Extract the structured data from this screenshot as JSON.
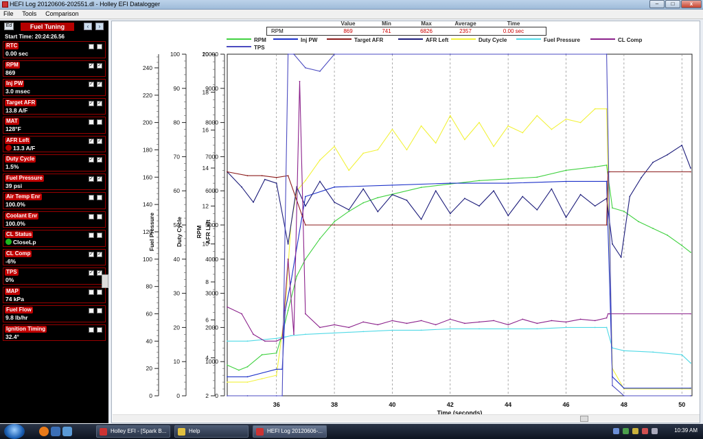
{
  "window": {
    "title": "HEFI Log 20120606-202551.dl - Holley EFI Datalogger",
    "min_label": "–",
    "max_label": "□",
    "close_label": "x"
  },
  "menu": [
    "File",
    "Tools",
    "Comparison"
  ],
  "sidebar": {
    "ed_label": "Ed",
    "title": "Fuel Tuning",
    "start_time": "Start Time: 20:24:26.56",
    "params": [
      {
        "label": "RTC",
        "value": "0.00 sec",
        "chk1": false,
        "chk2": false
      },
      {
        "label": "RPM",
        "value": "869",
        "chk1": true,
        "chk2": true
      },
      {
        "label": "Inj PW",
        "value": "3.0 msec",
        "chk1": true,
        "chk2": true
      },
      {
        "label": "Target AFR",
        "value": "13.8 A/F",
        "chk1": true,
        "chk2": true
      },
      {
        "label": "MAT",
        "value": "128°F",
        "chk1": false,
        "chk2": false
      },
      {
        "label": "AFR Left",
        "value": "13.3 A/F",
        "chk1": true,
        "chk2": true,
        "dot": "#c00000"
      },
      {
        "label": "Duty Cycle",
        "value": "1.5%",
        "chk1": true,
        "chk2": true
      },
      {
        "label": "Fuel Pressure",
        "value": "39 psi",
        "chk1": true,
        "chk2": true
      },
      {
        "label": "Air Temp Enr",
        "value": "100.0%",
        "chk1": false,
        "chk2": false
      },
      {
        "label": "Coolant Enr",
        "value": "100.0%",
        "chk1": false,
        "chk2": false
      },
      {
        "label": "CL Status",
        "value": "CloseLp",
        "chk1": false,
        "chk2": false,
        "dot": "#1fb81f"
      },
      {
        "label": "CL Comp",
        "value": "-6%",
        "chk1": true,
        "chk2": true
      },
      {
        "label": "TPS",
        "value": "0%",
        "chk1": true,
        "chk2": true
      },
      {
        "label": "MAP",
        "value": "74 kPa",
        "chk1": false,
        "chk2": false
      },
      {
        "label": "Fuel Flow",
        "value": "9.8 lb/hr",
        "chk1": false,
        "chk2": false
      },
      {
        "label": "Ignition Timing",
        "value": "32.4°",
        "chk1": false,
        "chk2": false
      }
    ]
  },
  "readout": {
    "headers": [
      "Value",
      "Min",
      "Max",
      "Average",
      "Time"
    ],
    "channel": "RPM",
    "values": [
      "869",
      "741",
      "6826",
      "2357",
      "0.00 sec"
    ]
  },
  "legend": [
    {
      "name": "RPM",
      "color": "#3fd13f"
    },
    {
      "name": "Inj PW",
      "color": "#1a2fc8"
    },
    {
      "name": "Target AFR",
      "color": "#8b1a1a"
    },
    {
      "name": "AFR Left",
      "color": "#1c1c7a"
    },
    {
      "name": "Duty Cycle",
      "color": "#f2f23a"
    },
    {
      "name": "Fuel Pressure",
      "color": "#4fd9e6"
    },
    {
      "name": "CL Comp",
      "color": "#8a1f8a"
    },
    {
      "name": "TPS",
      "color": "#4a4ac0"
    }
  ],
  "chart_data": {
    "type": "line",
    "xlabel": "Time (seconds)",
    "xlim": [
      34.3,
      50.35
    ],
    "xticks": [
      36,
      38,
      40,
      42,
      44,
      46,
      48,
      50
    ],
    "grid": true,
    "axes": [
      {
        "label": "Fuel Pressure",
        "range": [
          0,
          250
        ],
        "ticks": [
          0,
          20,
          40,
          60,
          80,
          100,
          120,
          140,
          160,
          180,
          200,
          220,
          240
        ]
      },
      {
        "label": "Duty Cycle",
        "range": [
          0,
          100
        ],
        "ticks": [
          0,
          10,
          20,
          30,
          40,
          50,
          60,
          70,
          80,
          90,
          100
        ]
      },
      {
        "label": "AFR Left",
        "range": [
          2,
          20
        ],
        "ticks": [
          2,
          4,
          6,
          8,
          10,
          12,
          14,
          16,
          18,
          20
        ]
      },
      {
        "label": "RPM",
        "range": [
          0,
          10000
        ],
        "ticks": [
          0,
          1000,
          2000,
          3000,
          4000,
          5000,
          6000,
          7000,
          8000,
          9000,
          10000
        ]
      }
    ],
    "series": [
      {
        "name": "RPM",
        "axis": 3,
        "x": [
          34.3,
          34.7,
          35.0,
          35.5,
          36.0,
          36.2,
          36.4,
          36.7,
          37.0,
          37.5,
          38.0,
          38.5,
          39.0,
          39.5,
          40.0,
          41.0,
          42.0,
          43.0,
          44.0,
          45.0,
          46.0,
          47.0,
          47.4,
          47.6,
          48.0,
          48.5,
          49.0,
          49.5,
          50.0,
          50.3
        ],
        "y": [
          900,
          750,
          850,
          1200,
          1250,
          1800,
          2500,
          3500,
          4000,
          4600,
          5100,
          5400,
          5650,
          5800,
          5900,
          6100,
          6200,
          6300,
          6350,
          6400,
          6600,
          6700,
          6750,
          5500,
          5400,
          5100,
          4900,
          4700,
          4400,
          4200
        ]
      },
      {
        "name": "Duty Cycle",
        "axis": 1,
        "x": [
          34.3,
          35.0,
          35.5,
          36.0,
          36.3,
          36.5,
          36.7,
          37.0,
          37.5,
          38.0,
          38.5,
          39.0,
          39.5,
          40.0,
          40.5,
          41.0,
          41.5,
          42.0,
          42.5,
          43.0,
          43.5,
          44.0,
          44.5,
          45.0,
          45.5,
          46.0,
          46.5,
          47.0,
          47.4,
          47.6,
          48.0,
          50.3
        ],
        "y": [
          4,
          4,
          5,
          6,
          25,
          50,
          60,
          63,
          69,
          73,
          66,
          71,
          72,
          78,
          72,
          79,
          74,
          82,
          75,
          80,
          73,
          79,
          77,
          82,
          78,
          81,
          80,
          84,
          84,
          8,
          2,
          2
        ]
      },
      {
        "name": "Fuel Pressure",
        "axis": 0,
        "x": [
          34.3,
          35.0,
          35.5,
          36.0,
          36.3,
          36.5,
          37.0,
          38.0,
          39.0,
          40.0,
          41.0,
          42.0,
          43.0,
          44.0,
          45.0,
          46.0,
          47.0,
          47.4,
          47.6,
          48.0,
          49.0,
          50.0,
          50.3
        ],
        "y": [
          40,
          40,
          41,
          42,
          43,
          44,
          45,
          46,
          47,
          48,
          48,
          49,
          49,
          49,
          49,
          50,
          50,
          50,
          35,
          33,
          32,
          30,
          24
        ]
      },
      {
        "name": "Inj PW",
        "axis": 2,
        "x": [
          34.3,
          35.0,
          36.0,
          36.2,
          36.3,
          36.5,
          37.0,
          38.0,
          40.0,
          42.0,
          44.0,
          46.0,
          47.4,
          47.6,
          48.0,
          50.3
        ],
        "y": [
          3.0,
          3.0,
          3.4,
          3.4,
          6.5,
          8.0,
          12.5,
          13.0,
          13.1,
          13.2,
          13.2,
          13.3,
          13.3,
          3.0,
          2.4,
          2.4
        ]
      },
      {
        "name": "AFR Left",
        "axis": 2,
        "x": [
          34.3,
          34.8,
          35.2,
          35.6,
          36.0,
          36.4,
          36.7,
          37.0,
          37.5,
          38.0,
          38.5,
          39.0,
          39.5,
          40.0,
          40.5,
          41.0,
          41.5,
          42.0,
          42.5,
          43.0,
          43.5,
          44.0,
          44.5,
          45.0,
          45.5,
          46.0,
          46.5,
          47.0,
          47.4,
          47.6,
          47.9,
          48.2,
          48.6,
          49.0,
          49.5,
          50.0,
          50.3
        ],
        "y": [
          13.8,
          13.0,
          12.2,
          13.4,
          13.2,
          10.0,
          13.0,
          12.0,
          13.3,
          12.2,
          11.8,
          12.9,
          11.7,
          12.6,
          12.3,
          11.3,
          12.8,
          11.6,
          12.4,
          12.0,
          12.8,
          11.5,
          12.5,
          11.8,
          12.9,
          11.4,
          12.6,
          12.0,
          12.4,
          10.0,
          9.3,
          12.5,
          13.5,
          14.3,
          14.7,
          15.2,
          14.0
        ]
      },
      {
        "name": "Target AFR",
        "axis": 2,
        "x": [
          34.3,
          35.0,
          35.5,
          36.0,
          36.4,
          37.0,
          38.0,
          40.0,
          42.0,
          44.0,
          46.0,
          47.4,
          47.45,
          47.5,
          50.3
        ],
        "y": [
          13.8,
          13.6,
          13.6,
          13.5,
          13.6,
          11.0,
          11.0,
          11.0,
          11.0,
          11.0,
          11.0,
          11.0,
          13.8,
          13.8,
          13.8
        ]
      },
      {
        "name": "CL Comp",
        "axis": 0,
        "x": [
          34.3,
          34.8,
          35.2,
          35.6,
          36.0,
          36.2,
          36.4,
          36.6,
          36.8,
          37.0,
          37.5,
          38.0,
          38.5,
          39.0,
          39.5,
          40.0,
          40.5,
          41.0,
          41.5,
          42.0,
          42.5,
          43.0,
          43.5,
          44.0,
          44.5,
          45.0,
          45.5,
          46.0,
          46.5,
          47.0,
          47.4,
          47.45,
          47.5,
          50.3
        ],
        "y": [
          65,
          60,
          45,
          40,
          40,
          42,
          100,
          45,
          230,
          60,
          50,
          52,
          50,
          54,
          52,
          55,
          53,
          55,
          52,
          56,
          53,
          54,
          55,
          52,
          56,
          53,
          55,
          54,
          56,
          55,
          57,
          60,
          60,
          60
        ]
      },
      {
        "name": "TPS",
        "axis": 1,
        "x": [
          34.3,
          35.0,
          36.0,
          36.2,
          36.4,
          36.6,
          37.0,
          37.5,
          38.0,
          40.0,
          42.0,
          44.0,
          46.0,
          47.4,
          47.6,
          48.0,
          50.3
        ],
        "y": [
          0,
          0,
          0,
          0,
          100,
          100,
          96,
          95,
          100,
          100,
          100,
          100,
          100,
          100,
          3,
          0,
          0
        ]
      }
    ]
  },
  "taskbar": {
    "tasks": [
      "Holley EFI - [Spark B...",
      "Help",
      "HEFI Log 20120606-..."
    ],
    "clock": "10:39 AM"
  }
}
